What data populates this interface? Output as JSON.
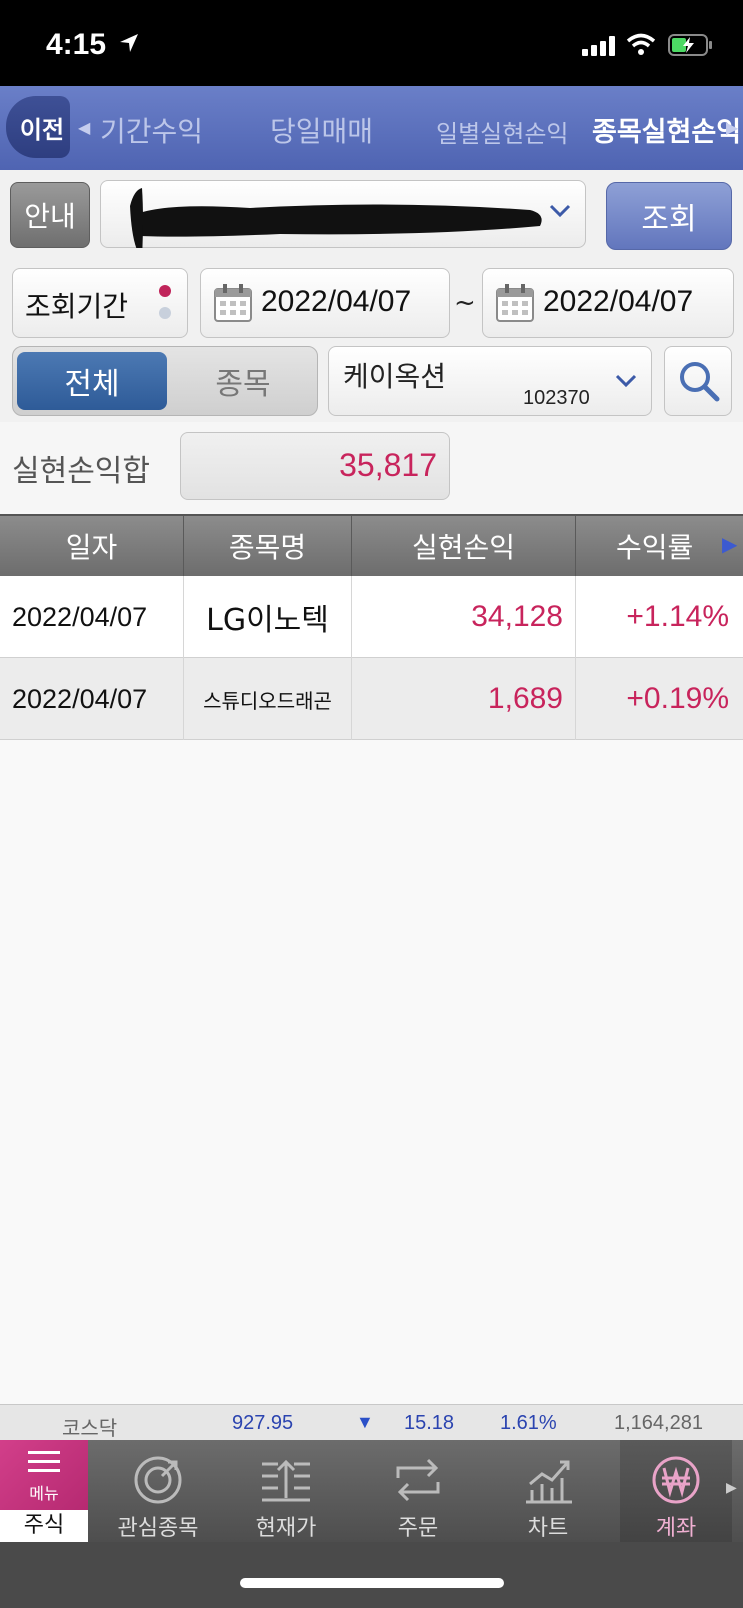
{
  "status_bar": {
    "time": "4:15"
  },
  "nav": {
    "back_label": "이전",
    "tabs": [
      "기간수익",
      "당일매매",
      "일별실현손익",
      "종목실현손익"
    ]
  },
  "account": {
    "guide_label": "안내",
    "query_label": "조회"
  },
  "period": {
    "label": "조회기간",
    "start_date": "2022/04/07",
    "separator": "~",
    "end_date": "2022/04/07"
  },
  "filter": {
    "all_label": "전체",
    "item_label": "종목",
    "stock_name": "케이옥션",
    "stock_code": "102370"
  },
  "summary": {
    "label": "실현손익합",
    "value": "35,817"
  },
  "table": {
    "headers": [
      "일자",
      "종목명",
      "실현손익",
      "수익률"
    ],
    "rows": [
      {
        "date": "2022/04/07",
        "name": "LG이노텍",
        "pnl": "34,128",
        "rate": "+1.14%"
      },
      {
        "date": "2022/04/07",
        "name": "스튜디오드래곤",
        "pnl": "1,689",
        "rate": "+0.19%"
      }
    ]
  },
  "ticker": {
    "index": "코스닥",
    "value": "927.95",
    "change": "15.18",
    "pct": "1.61%",
    "volume": "1,164,281"
  },
  "tabbar": {
    "menu_label": "메뉴",
    "stock_label": "주식",
    "items": [
      "관심종목",
      "현재가",
      "주문",
      "차트",
      "계좌"
    ]
  },
  "colors": {
    "nav": "#5a6fbc",
    "positive": "#c8245c",
    "down_arrow": "#2b50c8"
  }
}
